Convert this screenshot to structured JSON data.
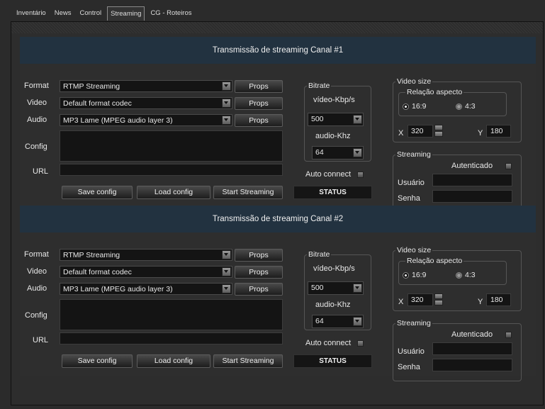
{
  "tabs": [
    "Inventário",
    "News",
    "Control",
    "Streaming",
    "CG - Roteiros"
  ],
  "active_tab": "Streaming",
  "channels": [
    {
      "title": "Transmissão de streaming Canal #1",
      "format_label": "Format",
      "video_label": "Video",
      "audio_label": "Audio",
      "config_label": "Config",
      "url_label": "URL",
      "format_value": "RTMP Streaming",
      "video_value": "Default format codec",
      "audio_value": "MP3 Lame (MPEG audio layer 3)",
      "props_label": "Props",
      "save_label": "Save config",
      "load_label": "Load config",
      "start_label": "Start Streaming",
      "bitrate_title": "Bitrate",
      "video_kbps_label": "vídeo-Kbp/s",
      "video_kbps_value": "500",
      "audio_khz_label": "audio-Khz",
      "audio_khz_value": "64",
      "auto_connect_label": "Auto connect",
      "status_label": "STATUS",
      "video_size_title": "Video size",
      "aspect_title": "Relação aspecto",
      "aspect_169": "16:9",
      "aspect_43": "4:3",
      "x_label": "X",
      "x_value": "320",
      "y_label": "Y",
      "y_value": "180",
      "streaming_title": "Streaming",
      "autenticado_label": "Autenticado",
      "usuario_label": "Usuário",
      "senha_label": "Senha"
    },
    {
      "title": "Transmissão de streaming Canal #2",
      "format_label": "Format",
      "video_label": "Video",
      "audio_label": "Audio",
      "config_label": "Config",
      "url_label": "URL",
      "format_value": "RTMP Streaming",
      "video_value": "Default format codec",
      "audio_value": "MP3 Lame (MPEG audio layer 3)",
      "props_label": "Props",
      "save_label": "Save config",
      "load_label": "Load config",
      "start_label": "Start Streaming",
      "bitrate_title": "Bitrate",
      "video_kbps_label": "vídeo-Kbp/s",
      "video_kbps_value": "500",
      "audio_khz_label": "audio-Khz",
      "audio_khz_value": "64",
      "auto_connect_label": "Auto connect",
      "status_label": "STATUS",
      "video_size_title": "Video size",
      "aspect_title": "Relação aspecto",
      "aspect_169": "16:9",
      "aspect_43": "4:3",
      "x_label": "X",
      "x_value": "320",
      "y_label": "Y",
      "y_value": "180",
      "streaming_title": "Streaming",
      "autenticado_label": "Autenticado",
      "usuario_label": "Usuário",
      "senha_label": "Senha"
    }
  ]
}
